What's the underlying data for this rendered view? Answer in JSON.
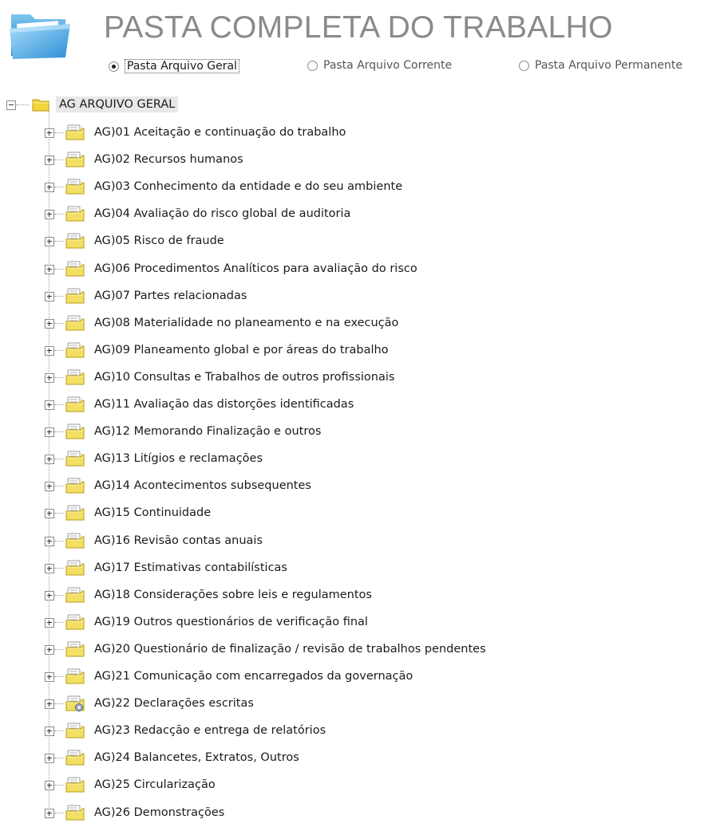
{
  "header": {
    "title": "PASTA COMPLETA DO TRABALHO",
    "icon": "folder-icon"
  },
  "radio_options": [
    {
      "label": "Pasta Arquivo Geral",
      "selected": true
    },
    {
      "label": "Pasta Arquivo Corrente",
      "selected": false
    },
    {
      "label": "Pasta Arquivo Permanente",
      "selected": false
    }
  ],
  "tree": {
    "root": {
      "label": "AG ARQUIVO GERAL",
      "expanded": true,
      "icon": "folder-icon"
    },
    "items": [
      {
        "label": "AG)01 Aceitação e continuação do trabalho",
        "icon": "document-folder-icon"
      },
      {
        "label": "AG)02 Recursos humanos",
        "icon": "document-folder-icon"
      },
      {
        "label": "AG)03 Conhecimento da entidade e do seu ambiente",
        "icon": "document-folder-icon"
      },
      {
        "label": "AG)04 Avaliação do risco global de auditoria",
        "icon": "document-folder-icon"
      },
      {
        "label": "AG)05 Risco de fraude",
        "icon": "document-folder-icon"
      },
      {
        "label": "AG)06 Procedimentos Analíticos para avaliação do risco",
        "icon": "document-folder-icon"
      },
      {
        "label": "AG)07 Partes relacionadas",
        "icon": "document-folder-icon"
      },
      {
        "label": "AG)08 Materialidade no planeamento e na execução",
        "icon": "document-folder-icon"
      },
      {
        "label": "AG)09 Planeamento global e por áreas do trabalho",
        "icon": "document-folder-icon"
      },
      {
        "label": "AG)10 Consultas e Trabalhos de outros profissionais",
        "icon": "document-folder-icon"
      },
      {
        "label": "AG)11 Avaliação das distorções identificadas",
        "icon": "document-folder-icon"
      },
      {
        "label": "AG)12 Memorando Finalização e outros",
        "icon": "document-folder-icon"
      },
      {
        "label": "AG)13 Litígios e reclamações",
        "icon": "document-folder-icon"
      },
      {
        "label": "AG)14 Acontecimentos subsequentes",
        "icon": "document-folder-icon"
      },
      {
        "label": "AG)15 Continuidade",
        "icon": "document-folder-icon"
      },
      {
        "label": "AG)16 Revisão contas anuais",
        "icon": "document-folder-icon"
      },
      {
        "label": "AG)17 Estimativas contabilísticas",
        "icon": "document-folder-icon"
      },
      {
        "label": "AG)18 Considerações sobre leis e regulamentos",
        "icon": "document-folder-icon"
      },
      {
        "label": "AG)19 Outros questionários de verificação final",
        "icon": "document-folder-icon"
      },
      {
        "label": "AG)20 Questionário de finalização / revisão de trabalhos pendentes",
        "icon": "document-folder-icon"
      },
      {
        "label": "AG)21 Comunicação com encarregados da governação",
        "icon": "document-folder-icon"
      },
      {
        "label": "AG)22 Declarações escritas",
        "icon": "gear-folder-icon"
      },
      {
        "label": "AG)23 Redacção e entrega de relatórios",
        "icon": "document-folder-icon"
      },
      {
        "label": "AG)24 Balancetes, Extratos, Outros",
        "icon": "document-folder-icon"
      },
      {
        "label": "AG)25 Circularização",
        "icon": "document-folder-icon"
      },
      {
        "label": "AG)26 Demonstrações",
        "icon": "document-folder-icon"
      }
    ]
  }
}
